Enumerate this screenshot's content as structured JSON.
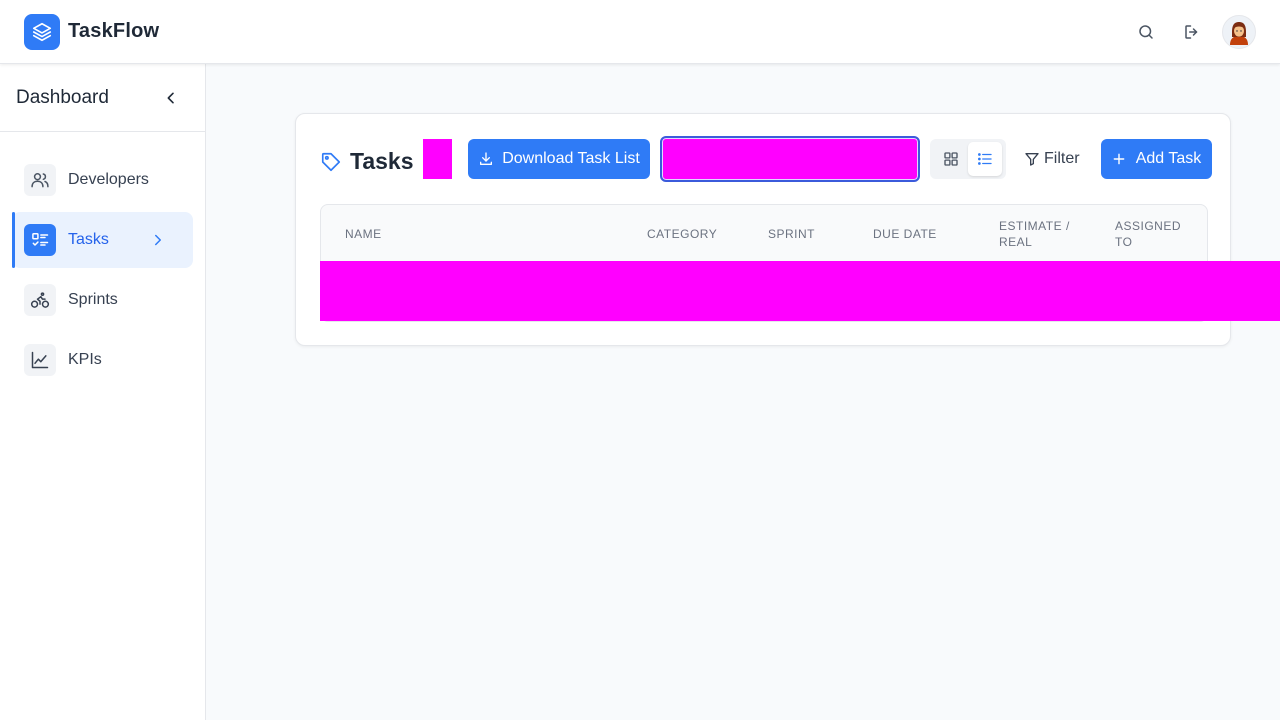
{
  "app": {
    "name": "TaskFlow"
  },
  "header": {
    "search_icon": "search-icon",
    "logout_icon": "logout-icon",
    "avatar_icon": "user-avatar"
  },
  "sidebar": {
    "title": "Dashboard",
    "items": [
      {
        "label": "Developers",
        "icon": "users-icon",
        "active": false
      },
      {
        "label": "Tasks",
        "icon": "list-check-icon",
        "active": true
      },
      {
        "label": "Sprints",
        "icon": "bike-icon",
        "active": false
      },
      {
        "label": "KPIs",
        "icon": "chart-line-icon",
        "active": false
      }
    ]
  },
  "tasks_panel": {
    "title": "Tasks",
    "download_label": "Download Task List",
    "filter_label": "Filter",
    "add_label": "Add Task",
    "view_mode": "list",
    "columns": [
      "NAME",
      "CATEGORY",
      "SPRINT",
      "DUE DATE",
      "ESTIMATE /",
      "REAL",
      "ASSIGNED",
      "TO"
    ]
  },
  "colors": {
    "accent": "#2f7bf6",
    "redacted": "#ff00ff",
    "background": "#f8fafc"
  }
}
